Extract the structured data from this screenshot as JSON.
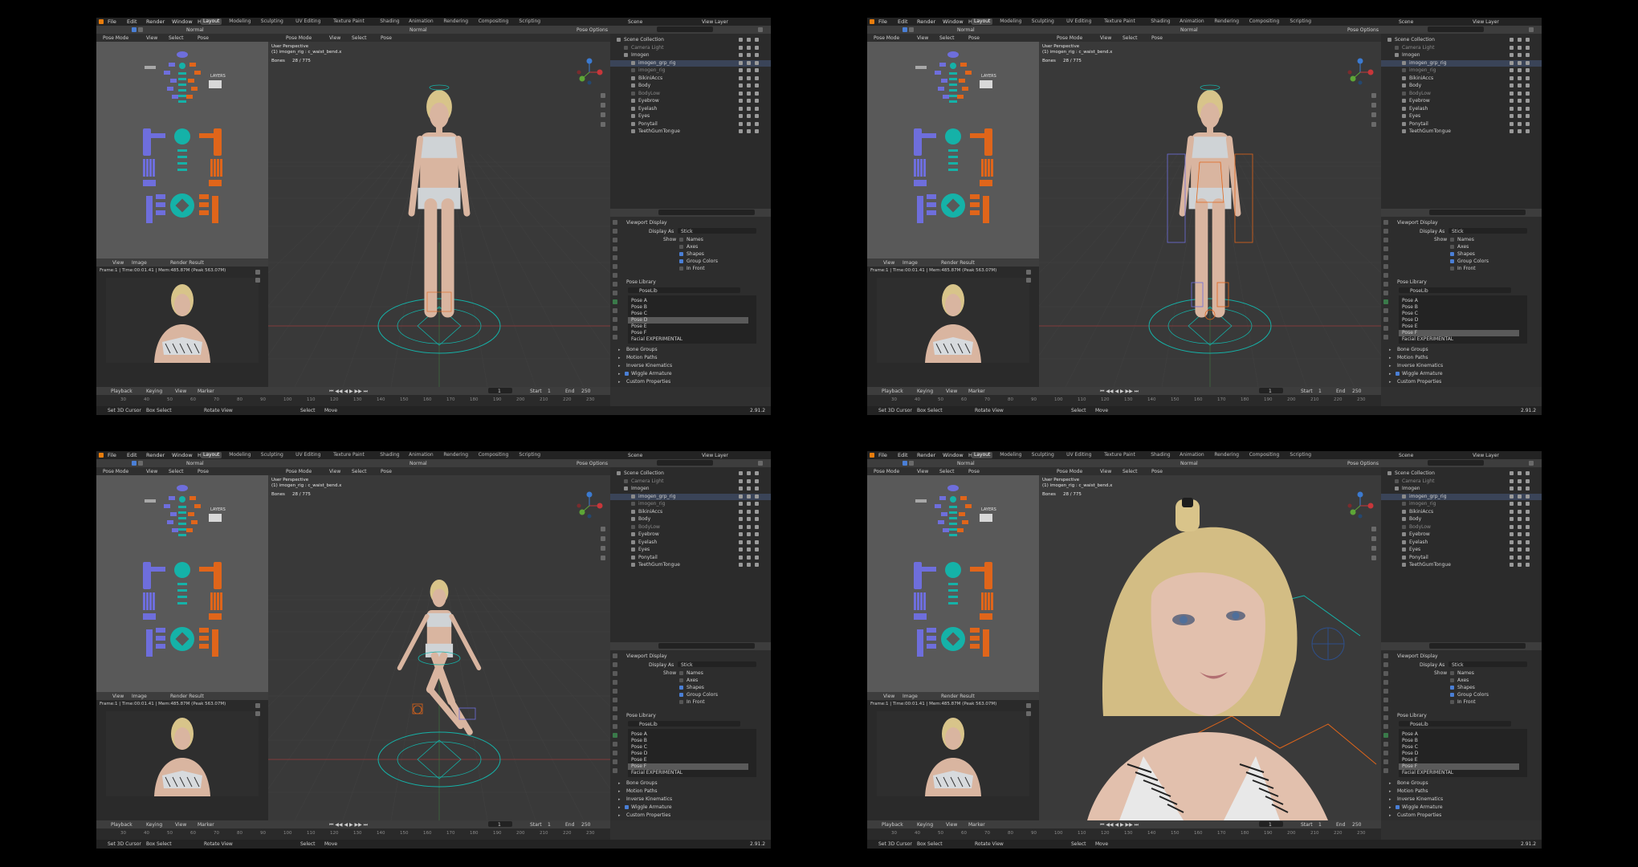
{
  "menus": [
    "File",
    "Edit",
    "Render",
    "Window",
    "Help"
  ],
  "workspaces": [
    "Layout",
    "Modeling",
    "Sculpting",
    "UV Editing",
    "Texture Paint",
    "Shading",
    "Animation",
    "Rendering",
    "Compositing",
    "Scripting"
  ],
  "active_workspace": "Layout",
  "scene_label": "Scene",
  "view_layer_label": "View Layer",
  "mode_label": "Pose Mode",
  "mode_menus": [
    "View",
    "Select",
    "Pose"
  ],
  "orientation": "Normal",
  "pose_options": "Pose Options",
  "viewport": {
    "title": "User Perspective",
    "subtitle": "(1) imogen_rig : c_waist_bend.x",
    "bones_label": "Bones",
    "bones_value": "28 / 775"
  },
  "picker": {
    "layers_label": "LAYERS"
  },
  "image_editor": {
    "menus": [
      "View",
      "Image"
    ],
    "slot": "Render Result",
    "info": "Frame:1 | Time:00:01.41 | Mem:485.87M (Peak 563.07M)"
  },
  "outliner": {
    "rows": [
      {
        "name": "Scene Collection",
        "depth": 0,
        "dim": false
      },
      {
        "name": "Camera Light",
        "depth": 1,
        "dim": true
      },
      {
        "name": "Imogen",
        "depth": 1,
        "dim": false
      },
      {
        "name": "imogen_grp_rig",
        "depth": 2,
        "dim": false
      },
      {
        "name": "imogen_rig",
        "depth": 2,
        "dim": true
      },
      {
        "name": "BikiniAccs",
        "depth": 2,
        "dim": false
      },
      {
        "name": "Body",
        "depth": 2,
        "dim": false
      },
      {
        "name": "BodyLow",
        "depth": 2,
        "dim": true
      },
      {
        "name": "Eyebrow",
        "depth": 2,
        "dim": false
      },
      {
        "name": "Eyelash",
        "depth": 2,
        "dim": false
      },
      {
        "name": "Eyes",
        "depth": 2,
        "dim": false
      },
      {
        "name": "Ponytail",
        "depth": 2,
        "dim": false
      },
      {
        "name": "TeethGumTongue",
        "depth": 2,
        "dim": false
      }
    ]
  },
  "properties": {
    "viewport_display": "Viewport Display",
    "display_as_label": "Display As",
    "display_as_value": "Stick",
    "show_label": "Show",
    "show_options": [
      {
        "label": "Names",
        "checked": false
      },
      {
        "label": "Axes",
        "checked": false
      },
      {
        "label": "Shapes",
        "checked": true
      },
      {
        "label": "Group Colors",
        "checked": true
      },
      {
        "label": "In Front",
        "checked": false
      }
    ],
    "pose_library": "Pose Library",
    "poselib_name": "PoseLib",
    "poses": [
      "Pose A",
      "Pose B",
      "Pose C",
      "Pose D",
      "Pose E",
      "Pose F",
      "Facial EXPERIMENTAL"
    ],
    "sections": [
      "Bone Groups",
      "Motion Paths",
      "Inverse Kinematics",
      "Wiggle Armature",
      "Custom Properties"
    ],
    "wiggle_checked": true
  },
  "timeline": {
    "menus": [
      "Playback",
      "Keying",
      "View",
      "Marker"
    ],
    "current_frame": "1",
    "start_label": "Start",
    "start_value": "1",
    "end_label": "End",
    "end_value": "250",
    "ticks": [
      "30",
      "40",
      "50",
      "60",
      "70",
      "80",
      "90",
      "100",
      "110",
      "120",
      "130",
      "140",
      "150",
      "160",
      "170",
      "180",
      "190",
      "200",
      "210",
      "220",
      "230"
    ]
  },
  "status": {
    "items": [
      "Set 3D Cursor",
      "Box Select",
      "Rotate View",
      "Select",
      "Move"
    ],
    "version": "2.91.2"
  },
  "panels": [
    {
      "selected_pose": "Pose D",
      "scene": "standing"
    },
    {
      "selected_pose": "Pose F",
      "scene": "standing_rig"
    },
    {
      "selected_pose": "Pose F",
      "scene": "sitting"
    },
    {
      "selected_pose": "Pose F",
      "scene": "closeup"
    }
  ],
  "colors": {
    "blue": "#6e6edc",
    "teal": "#15b2a8",
    "orange": "#e0651a",
    "axis_red": "#9a3b3b",
    "select_blue": "#4a7fd6"
  }
}
